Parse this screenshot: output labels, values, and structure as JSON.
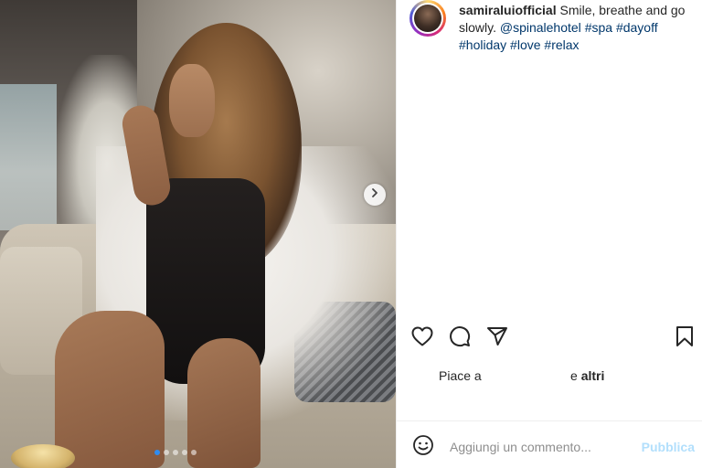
{
  "post": {
    "username": "samiraluiofficial",
    "caption_text": " Smile, breathe and go slowly. ",
    "mention": "@spinalehotel",
    "hashtags": [
      "#spa",
      "#dayoff",
      "#holiday",
      "#love",
      "#relax"
    ],
    "avatar_icon": "profile-avatar",
    "photo_description_icon": "photo",
    "carousel": {
      "total_slides": 5,
      "active_index": 0
    }
  },
  "actions": {
    "like_icon": "heart-icon",
    "comment_icon": "comment-bubble-icon",
    "share_icon": "paper-plane-icon",
    "save_icon": "bookmark-icon"
  },
  "likes": {
    "prefix": "Piace a",
    "suffix_pre": "e ",
    "suffix_bold": "altri"
  },
  "comment_box": {
    "emoji_icon": "smiley-icon",
    "placeholder": "Aggiungi un commento...",
    "publish_label": "Pubblica"
  },
  "colors": {
    "accent": "#0095f6",
    "publish_disabled": "#b2dffc",
    "link": "#00376b"
  }
}
